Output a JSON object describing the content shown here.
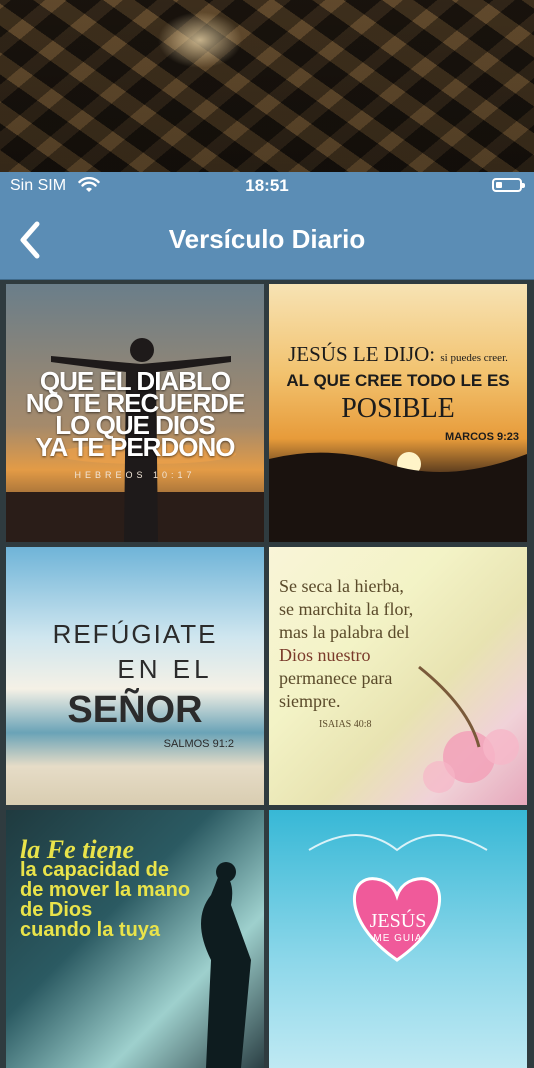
{
  "status_bar": {
    "carrier": "Sin SIM",
    "time": "18:51"
  },
  "nav": {
    "title": "Versículo Diario"
  },
  "tiles": [
    {
      "line1": "QUE EL DIABLO",
      "line2": "NO TE RECUERDE",
      "line3": "LO QUE DIOS",
      "line4": "YA TE PERDONO",
      "ref": "HEBREOS 10:17"
    },
    {
      "line1": "JESÚS LE DIJO:",
      "aside": "si puedes creer.",
      "line2": "AL QUE CREE TODO LE ES",
      "line3": "POSIBLE",
      "ref": "MARCOS 9:23"
    },
    {
      "line1": "REFÚGIATE",
      "line2": "EN EL",
      "line3": "SEÑOR",
      "ref": "SALMOS 91:2"
    },
    {
      "line1": "Se seca la hierba,",
      "line2": "se marchita la flor,",
      "line3": "mas la palabra del",
      "line4": "Dios nuestro",
      "line5": "permanece para",
      "line6": "siempre.",
      "ref": "ISAIAS 40:8"
    },
    {
      "line1": "la Fe tiene",
      "line2": "la capacidad de",
      "line3": "de mover la mano",
      "line4": "de Dios",
      "line5": "cuando la tuya"
    },
    {
      "line1": "JESÚS",
      "line2": "ME GUIA"
    }
  ]
}
